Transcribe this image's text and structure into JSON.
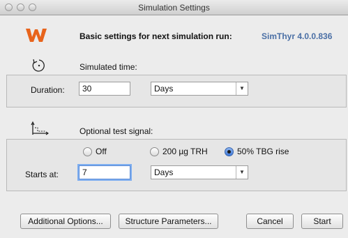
{
  "window": {
    "title": "Simulation Settings"
  },
  "header": {
    "heading": "Basic settings for next simulation run:",
    "version": "SimThyr 4.0.0.836"
  },
  "simulated_time": {
    "label": "Simulated time:",
    "duration_label": "Duration:",
    "duration_value": "30",
    "unit_selected": "Days"
  },
  "test_signal": {
    "label": "Optional test signal:",
    "options": [
      {
        "label": "Off",
        "selected": false
      },
      {
        "label": "200 µg TRH",
        "selected": false
      },
      {
        "label": "50% TBG rise",
        "selected": true
      }
    ],
    "starts_label": "Starts at:",
    "starts_value": "7",
    "unit_selected": "Days"
  },
  "buttons": {
    "additional_options": "Additional Options...",
    "structure_parameters": "Structure Parameters...",
    "cancel": "Cancel",
    "start": "Start"
  },
  "colors": {
    "logo": "#e8641c",
    "version": "#4a6fa5",
    "focus": "#7eaef0"
  }
}
